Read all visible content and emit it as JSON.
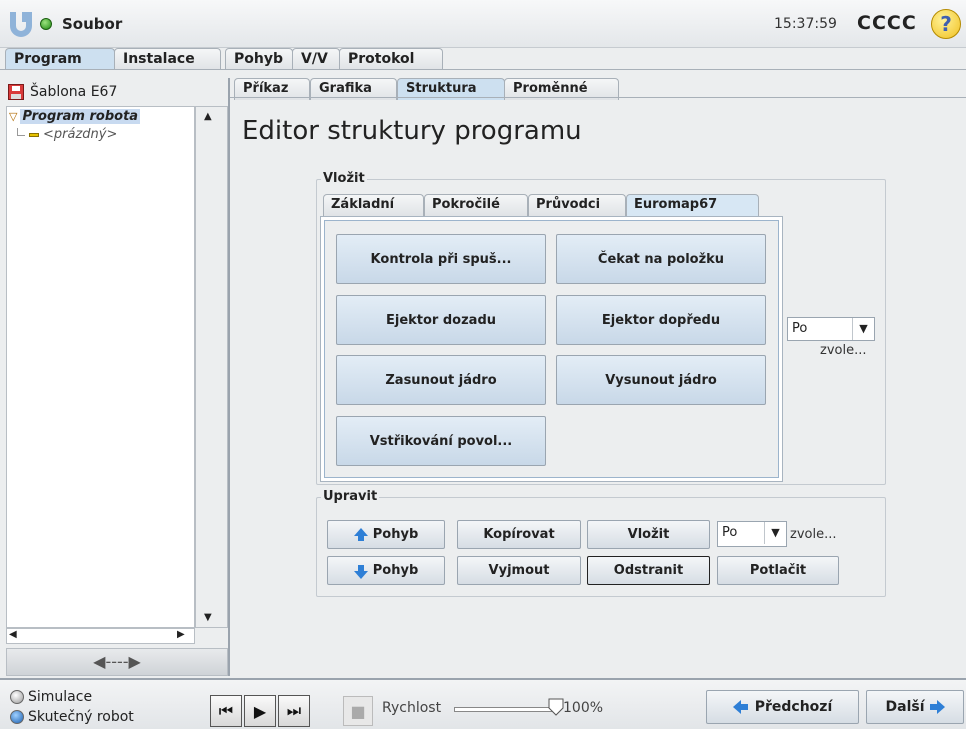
{
  "header": {
    "file_menu": "Soubor",
    "clock": "15:37:59",
    "robot_name": "CCCC",
    "help_label": "?"
  },
  "main_tabs": [
    "Program",
    "Instalace",
    "Pohyb",
    "V/V",
    "Protokol"
  ],
  "left": {
    "template_label": "Šablona E67",
    "tree_root": "Program robota",
    "tree_child": "<prázdný>"
  },
  "sub_tabs": [
    "Příkaz",
    "Grafika",
    "Struktura",
    "Proměnné"
  ],
  "editor": {
    "title": "Editor struktury programu",
    "insert_legend": "Vložit",
    "insert_tabs": [
      "Základní",
      "Pokročilé",
      "Průvodci",
      "Euromap67"
    ],
    "insert_buttons": [
      "Kontrola při spuš...",
      "Čekat na položku",
      "Ejektor dozadu",
      "Ejektor dopředu",
      "Zasunout jádro",
      "Vysunout jádro",
      "Vstřikování povol..."
    ],
    "insert_select_value": "Po",
    "insert_select_hint": "zvole...",
    "edit_legend": "Upravit",
    "edit_buttons": {
      "move_up": "Pohyb",
      "copy": "Kopírovat",
      "paste": "Vložit",
      "move_down": "Pohyb",
      "cut": "Vyjmout",
      "delete": "Odstranit",
      "suppress": "Potlačit"
    },
    "edit_select_value": "Po",
    "edit_select_hint": "zvole..."
  },
  "bottom": {
    "mode_simulation": "Simulace",
    "mode_real": "Skutečný robot",
    "speed_label": "Rychlost",
    "speed_value": "100%",
    "speed_fraction": 1.0,
    "prev_label": "Předchozí",
    "next_label": "Další"
  },
  "colors": {
    "accent_blue": "#2e7fd6",
    "active_tab": "#cde0f0",
    "status_green": "#1f8a12"
  }
}
